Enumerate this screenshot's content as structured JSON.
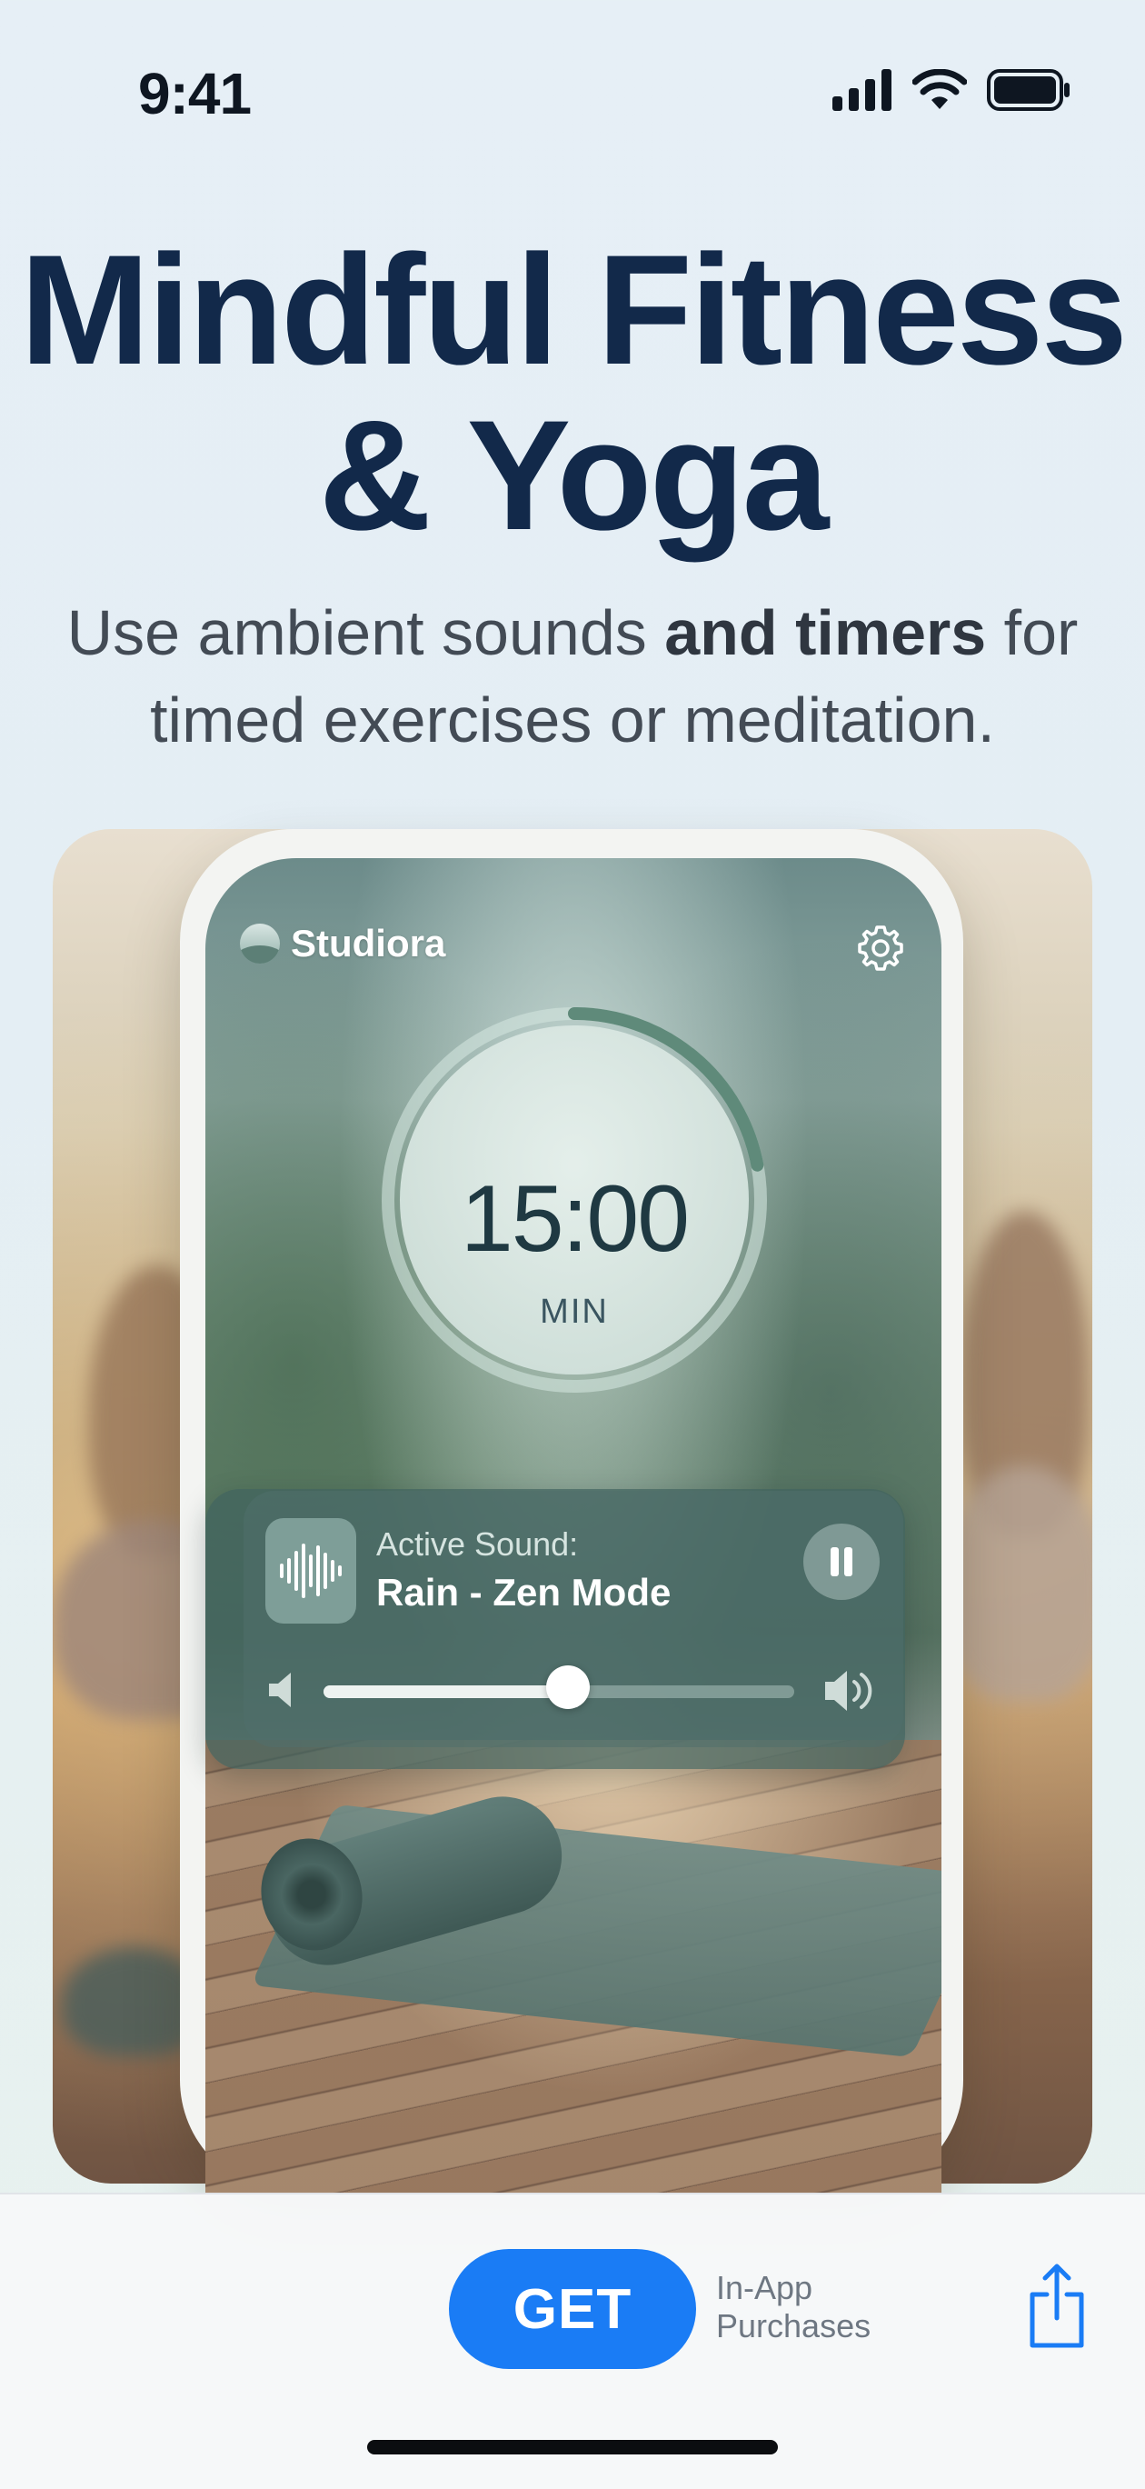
{
  "status_bar": {
    "time": "9:41",
    "icons": [
      "signal-icon",
      "wifi-icon",
      "battery-icon"
    ]
  },
  "headline": {
    "title_line1": "Mindful Fitness",
    "title_line2": "& Yoga",
    "subtitle_pre": "Use ambient sounds ",
    "subtitle_bold": "and timers",
    "subtitle_post": " for",
    "subtitle_line2": "timed exercises or meditation."
  },
  "app": {
    "brand": "Studiora",
    "timer": {
      "value": "15:00",
      "unit": "MIN",
      "progress": 0.22
    },
    "player": {
      "caption": "Active Sound:",
      "sound": "Rain - Zen Mode",
      "volume": 0.52
    }
  },
  "store_bar": {
    "get_label": "GET",
    "iap_line1": "In-App",
    "iap_line2": "Purchases"
  },
  "colors": {
    "title": "#12294a",
    "accent": "#1a7cf5",
    "ring": "#5f8a7a"
  }
}
